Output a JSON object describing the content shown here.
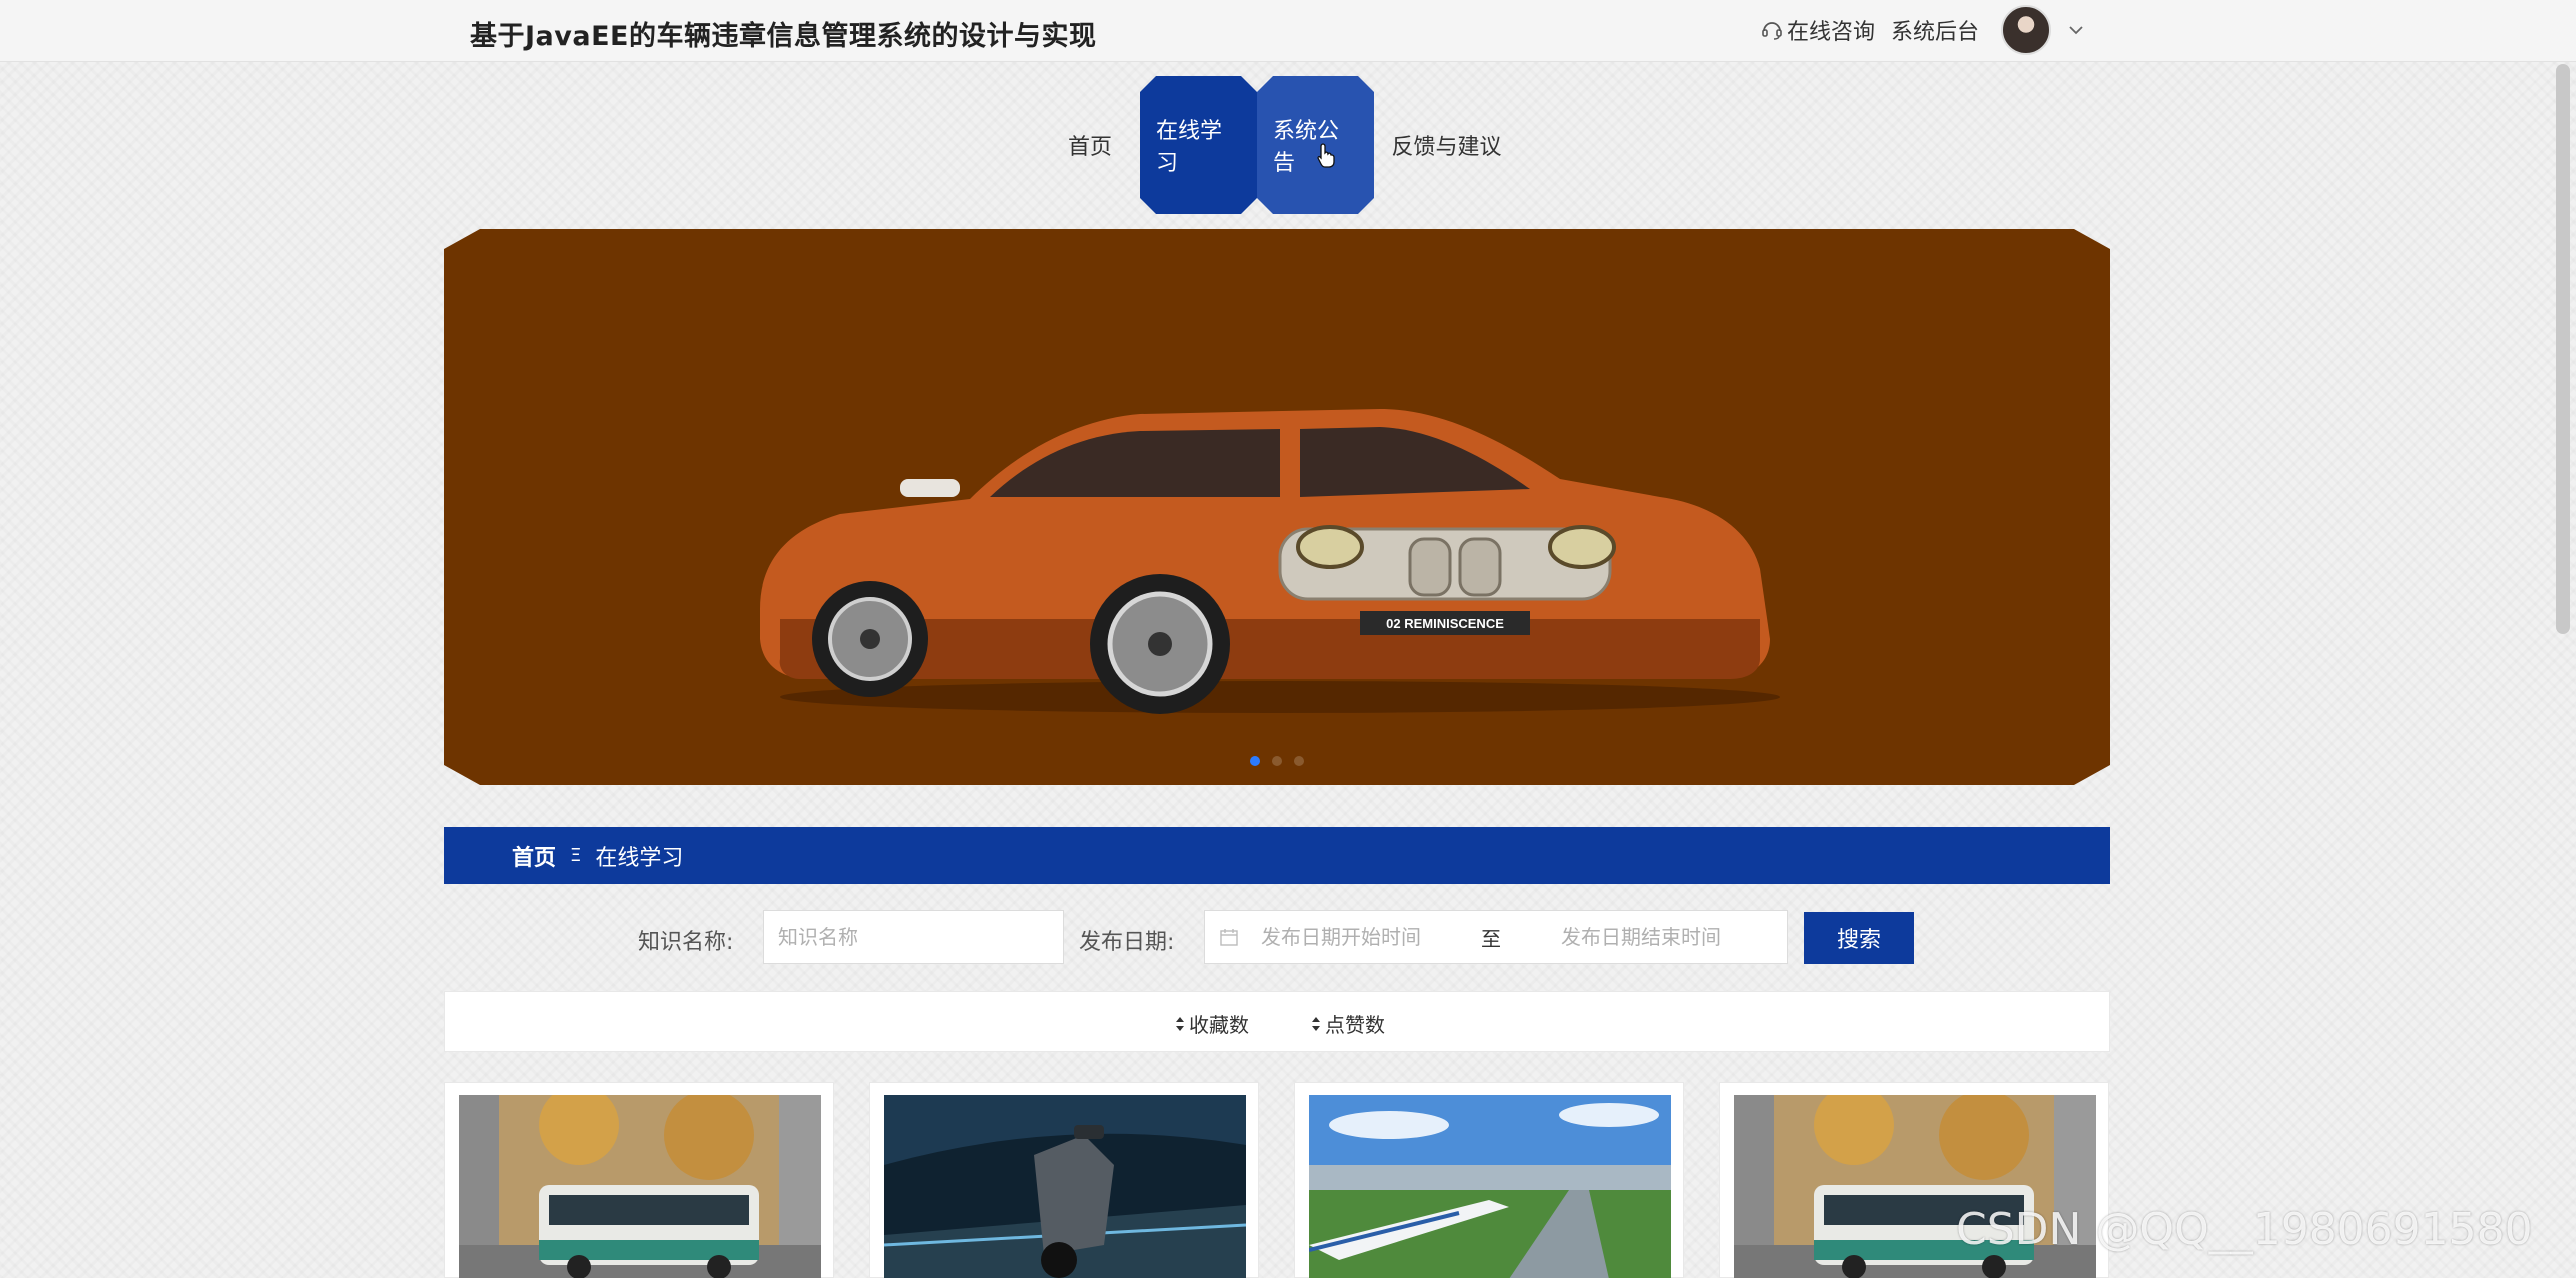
{
  "header": {
    "site_title": "基于JavaEE的车辆违章信息管理系统的设计与实现",
    "online_consult": "在线咨询",
    "admin": "系统后台"
  },
  "nav": {
    "items": [
      {
        "label": "首页"
      },
      {
        "label": "在线学习"
      },
      {
        "label": "系统公告"
      },
      {
        "label": "反馈与建议"
      }
    ]
  },
  "banner": {
    "plate_text": "02 REMINISCENCE",
    "slides": 3,
    "active_slide": 1
  },
  "breadcrumb": {
    "home": "首页",
    "separator": "Ξ",
    "current": "在线学习"
  },
  "search": {
    "name_label": "知识名称:",
    "name_placeholder": "知识名称",
    "date_label": "发布日期:",
    "date_start_placeholder": "发布日期开始时间",
    "date_to": "至",
    "date_end_placeholder": "发布日期结束时间",
    "button": "搜索"
  },
  "sort": {
    "favorites": "收藏数",
    "likes": "点赞数"
  },
  "cards": [
    {
      "image": "bus"
    },
    {
      "image": "scooter"
    },
    {
      "image": "train"
    },
    {
      "image": "bus"
    }
  ],
  "watermark": "CSDN @QQ__1980691580",
  "colors": {
    "primary": "#0d3a9c",
    "nav_hover": "#2853b0",
    "banner_bg": "#6e3400"
  }
}
